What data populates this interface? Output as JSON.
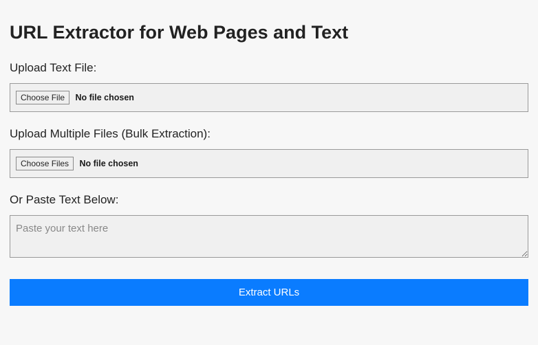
{
  "title": "URL Extractor for Web Pages and Text",
  "uploadSingle": {
    "label": "Upload Text File:",
    "buttonLabel": "Choose File",
    "status": "No file chosen"
  },
  "uploadBulk": {
    "label": "Upload Multiple Files (Bulk Extraction):",
    "buttonLabel": "Choose Files",
    "status": "No file chosen"
  },
  "pasteText": {
    "label": "Or Paste Text Below:",
    "placeholder": "Paste your text here",
    "value": ""
  },
  "extractButton": {
    "label": "Extract URLs"
  }
}
